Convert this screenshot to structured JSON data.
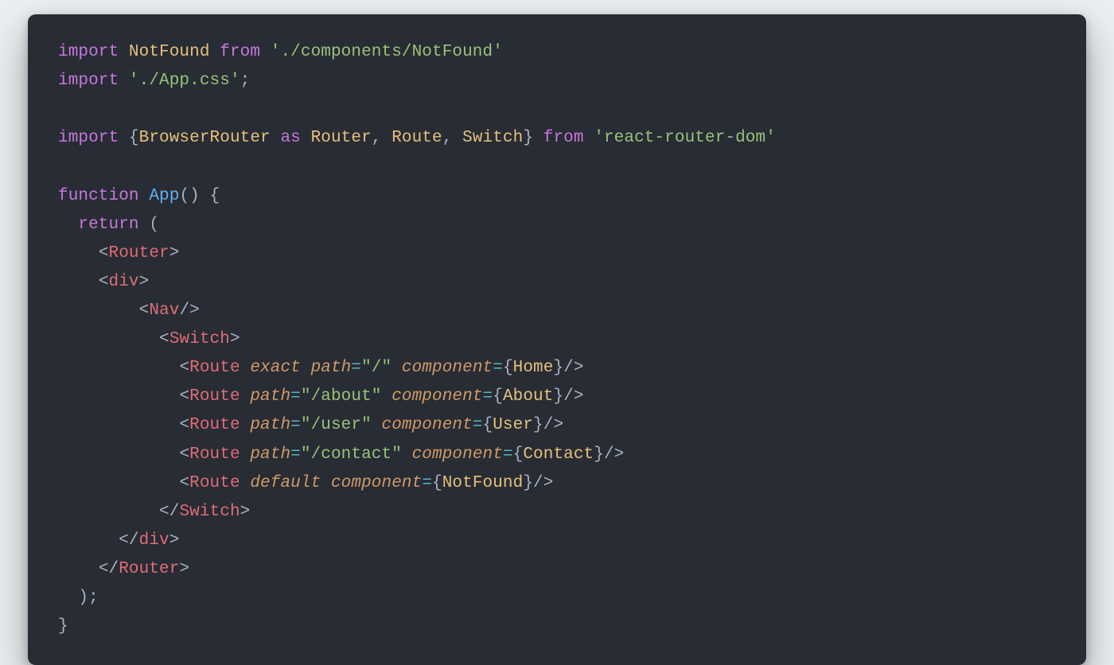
{
  "code": {
    "line1": {
      "kw_import": "import",
      "cls_notfound": "NotFound",
      "kw_from": "from",
      "str_path": "'./components/NotFound'"
    },
    "line2": {
      "kw_import": "import",
      "str_css": "'./App.css'",
      "semi": ";"
    },
    "line3": {
      "kw_import": "import",
      "brace_open": "{",
      "cls_browserrouter": "BrowserRouter",
      "kw_as": "as",
      "cls_router": "Router",
      "comma1": ",",
      "cls_route": "Route",
      "comma2": ",",
      "cls_switch": "Switch",
      "brace_close": "}",
      "kw_from": "from",
      "str_pkg": "'react-router-dom'"
    },
    "line4": {
      "kw_function": "function",
      "fn_app": "App",
      "paren_open": "(",
      "paren_close": ")",
      "brace_open": "{"
    },
    "line5": {
      "kw_return": "return",
      "paren_open": "("
    },
    "tags": {
      "router_open_lt": "<",
      "router_open_name": "Router",
      "router_open_gt": ">",
      "div_open_lt": "<",
      "div_open_name": "div",
      "div_open_gt": ">",
      "nav_lt": "<",
      "nav_name": "Nav",
      "nav_slash_gt": "/>",
      "switch_open_lt": "<",
      "switch_open_name": "Switch",
      "switch_open_gt": ">",
      "route1_lt": "<",
      "route1_name": "Route",
      "route1_exact": "exact",
      "route1_path_attr": "path",
      "route1_eq1": "=",
      "route1_path_val": "\"/\"",
      "route1_comp_attr": "component",
      "route1_eq2": "=",
      "route1_brace_open": "{",
      "route1_comp_val": "Home",
      "route1_brace_close": "}",
      "route1_slash_gt": "/>",
      "route2_lt": "<",
      "route2_name": "Route",
      "route2_path_attr": "path",
      "route2_eq1": "=",
      "route2_path_val": "\"/about\"",
      "route2_comp_attr": "component",
      "route2_eq2": "=",
      "route2_brace_open": "{",
      "route2_comp_val": "About",
      "route2_brace_close": "}",
      "route2_slash_gt": "/>",
      "route3_lt": "<",
      "route3_name": "Route",
      "route3_path_attr": "path",
      "route3_eq1": "=",
      "route3_path_val": "\"/user\"",
      "route3_comp_attr": "component",
      "route3_eq2": "=",
      "route3_brace_open": "{",
      "route3_comp_val": "User",
      "route3_brace_close": "}",
      "route3_slash_gt": "/>",
      "route4_lt": "<",
      "route4_name": "Route",
      "route4_path_attr": "path",
      "route4_eq1": "=",
      "route4_path_val": "\"/contact\"",
      "route4_comp_attr": "component",
      "route4_eq2": "=",
      "route4_brace_open": "{",
      "route4_comp_val": "Contact",
      "route4_brace_close": "}",
      "route4_slash_gt": "/>",
      "route5_lt": "<",
      "route5_name": "Route",
      "route5_default": "default",
      "route5_comp_attr": "component",
      "route5_eq2": "=",
      "route5_brace_open": "{",
      "route5_comp_val": "NotFound",
      "route5_brace_close": "}",
      "route5_slash_gt": "/>",
      "switch_close_lt": "<",
      "switch_close_slash": "/",
      "switch_close_name": "Switch",
      "switch_close_gt": ">",
      "div_close_lt": "<",
      "div_close_slash": "/",
      "div_close_name": "div",
      "div_close_gt": ">",
      "router_close_lt": "<",
      "router_close_slash": "/",
      "router_close_name": "Router",
      "router_close_gt": ">"
    },
    "line_close_paren": {
      "paren_close": ")",
      "semi": ";"
    },
    "line_close_brace": {
      "brace_close": "}"
    }
  }
}
